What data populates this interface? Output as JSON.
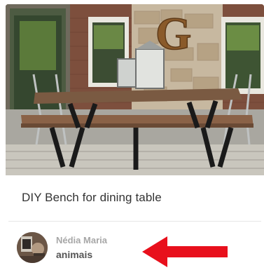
{
  "pin": {
    "title": "DIY Bench for dining table",
    "image_letter": "G"
  },
  "attribution": {
    "pinner_name": "Nédia Maria",
    "board_name": "animais"
  },
  "annotation": {
    "arrow_color": "#e8101c"
  }
}
